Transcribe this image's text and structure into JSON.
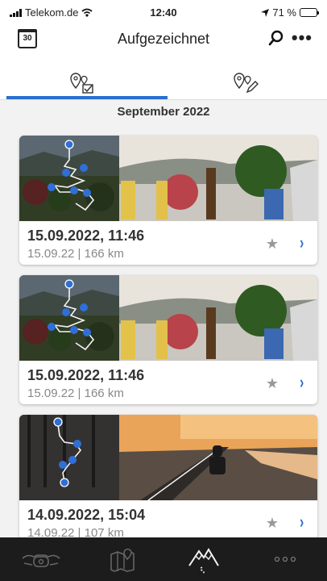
{
  "status_bar": {
    "carrier": "Telekom.de",
    "time": "12:40",
    "battery": "71 %",
    "battery_level": 0.71
  },
  "header": {
    "title": "Aufgezeichnet",
    "calendar_day": "30"
  },
  "tabs": [
    {
      "icon": "recorded-routes-icon",
      "active": true
    },
    {
      "icon": "planned-routes-icon",
      "active": false
    }
  ],
  "section": {
    "label": "September 2022"
  },
  "trips": [
    {
      "title": "15.09.2022, 11:46",
      "subtitle": "15.09.22 | 166 km",
      "star": "★",
      "chevron": "›"
    },
    {
      "title": "15.09.2022, 11:46",
      "subtitle": "15.09.22 | 166 km",
      "star": "★",
      "chevron": "›"
    },
    {
      "title": "14.09.2022, 15:04",
      "subtitle": "14.09.22 | 107 km",
      "star": "★",
      "chevron": "›"
    }
  ],
  "bottom_nav": [
    {
      "icon": "motorcycle-icon",
      "active": false
    },
    {
      "icon": "map-pin-icon",
      "active": false
    },
    {
      "icon": "mountain-route-icon",
      "active": true
    },
    {
      "icon": "more-dots-icon",
      "active": false
    }
  ],
  "colors": {
    "accent": "#2a6fd1",
    "route_dot": "#2f6fd6",
    "bottom_bar": "#1c1c1c"
  }
}
